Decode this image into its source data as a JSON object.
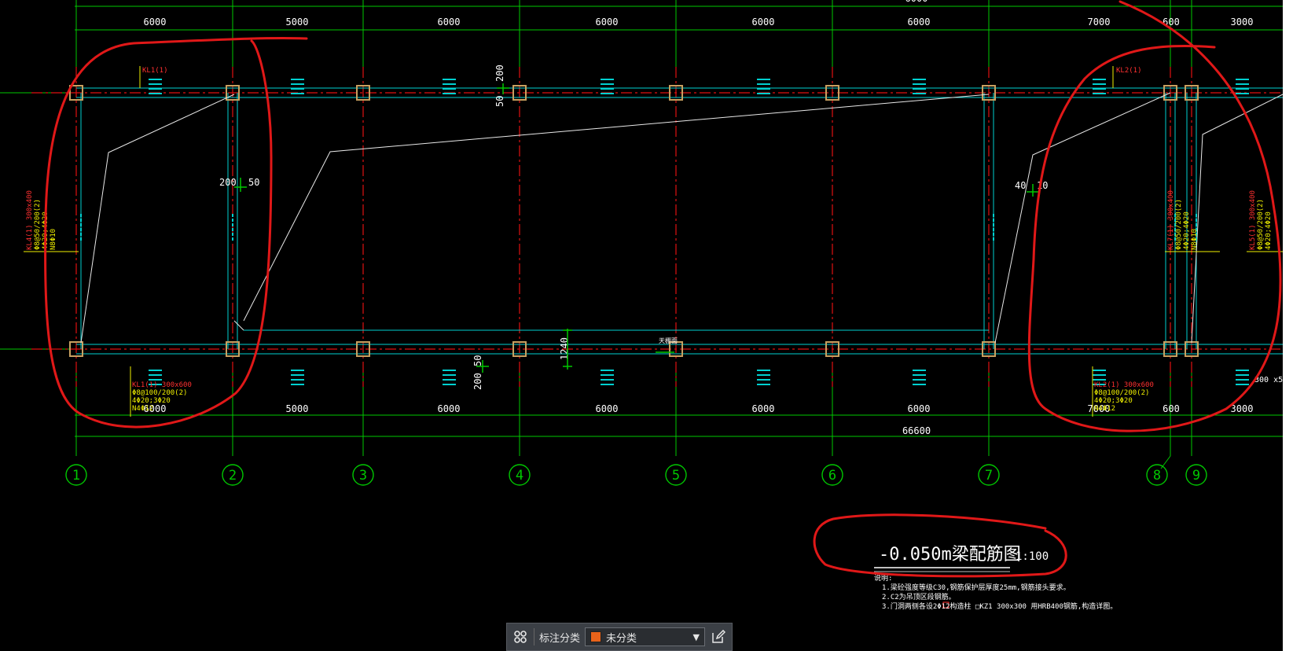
{
  "drawing": {
    "top_dims": [
      "6000",
      "5000",
      "6000",
      "6000",
      "6000",
      "6000",
      "7000",
      "600",
      "3000"
    ],
    "bottom_dims": [
      "6000",
      "5000",
      "6000",
      "6000",
      "6000",
      "6000",
      "7000",
      "600",
      "3000"
    ],
    "total_dim": "66600",
    "axes": [
      "1",
      "2",
      "3",
      "4",
      "5",
      "6",
      "7",
      "8",
      "9"
    ],
    "local_dims": {
      "d200_top": "200",
      "d50_top": "50",
      "d200_left": "200",
      "d50_left": "50",
      "d40": "40",
      "d10": "10",
      "d1240": "1240",
      "d50_bot": "50",
      "d200_bot": "200",
      "d300x": "300 x5"
    },
    "beam_labels": {
      "kl1_top": "KL1(1)",
      "kl2_top": "KL2(1)",
      "kl1_bottom": [
        "KL1(1) 300x600",
        "Φ8@100/200(2)",
        "4Φ20;3Φ20",
        "N4Φ12"
      ],
      "kl2_bottom": [
        "KL2(1) 300x600",
        "Φ8@100/200(2)",
        "4Φ20;3Φ20",
        "N4Φ12"
      ],
      "kl4_left": [
        "KL4(1) 300x400",
        "Φ8@50/200(2)",
        "4Φ20;4Φ20",
        "N8Φ10"
      ],
      "kl7_right": [
        "KL7(1) 300x400",
        "Φ8@50/200(2)",
        "4Φ20;4Φ20",
        "N8Φ10"
      ],
      "kl5_right": [
        "KL5(1) 300x400",
        "Φ8@50/200(2)",
        "4Φ20;4Φ20"
      ]
    },
    "title": {
      "main": "-0.050m梁配筋图",
      "scale": "1:100"
    },
    "notes": {
      "heading": "说明:",
      "lines": [
        "1.梁砼强度等级C30,钢筋保护层厚度25mm,钢筋接头要求。",
        "2.C2为吊顶区段钢筋。",
        "3.门洞两侧各设2Φ12构造柱    □KZ1 300x300 用HRB400钢筋,构造详图。"
      ]
    },
    "colors": {
      "grid": "#00c800",
      "axis": "#e01010",
      "beam": "#00d0d0",
      "column": "#c8a060",
      "text_yellow": "#f0f000",
      "text_red": "#ff3030",
      "markup": "#e01818",
      "dim_text": "#ffffff"
    }
  },
  "toolbar": {
    "grid_icon": "grid-icon",
    "label": "标注分类",
    "category_value": "未分类",
    "category_color": "#e8631a",
    "edit_icon": "edit-icon"
  }
}
